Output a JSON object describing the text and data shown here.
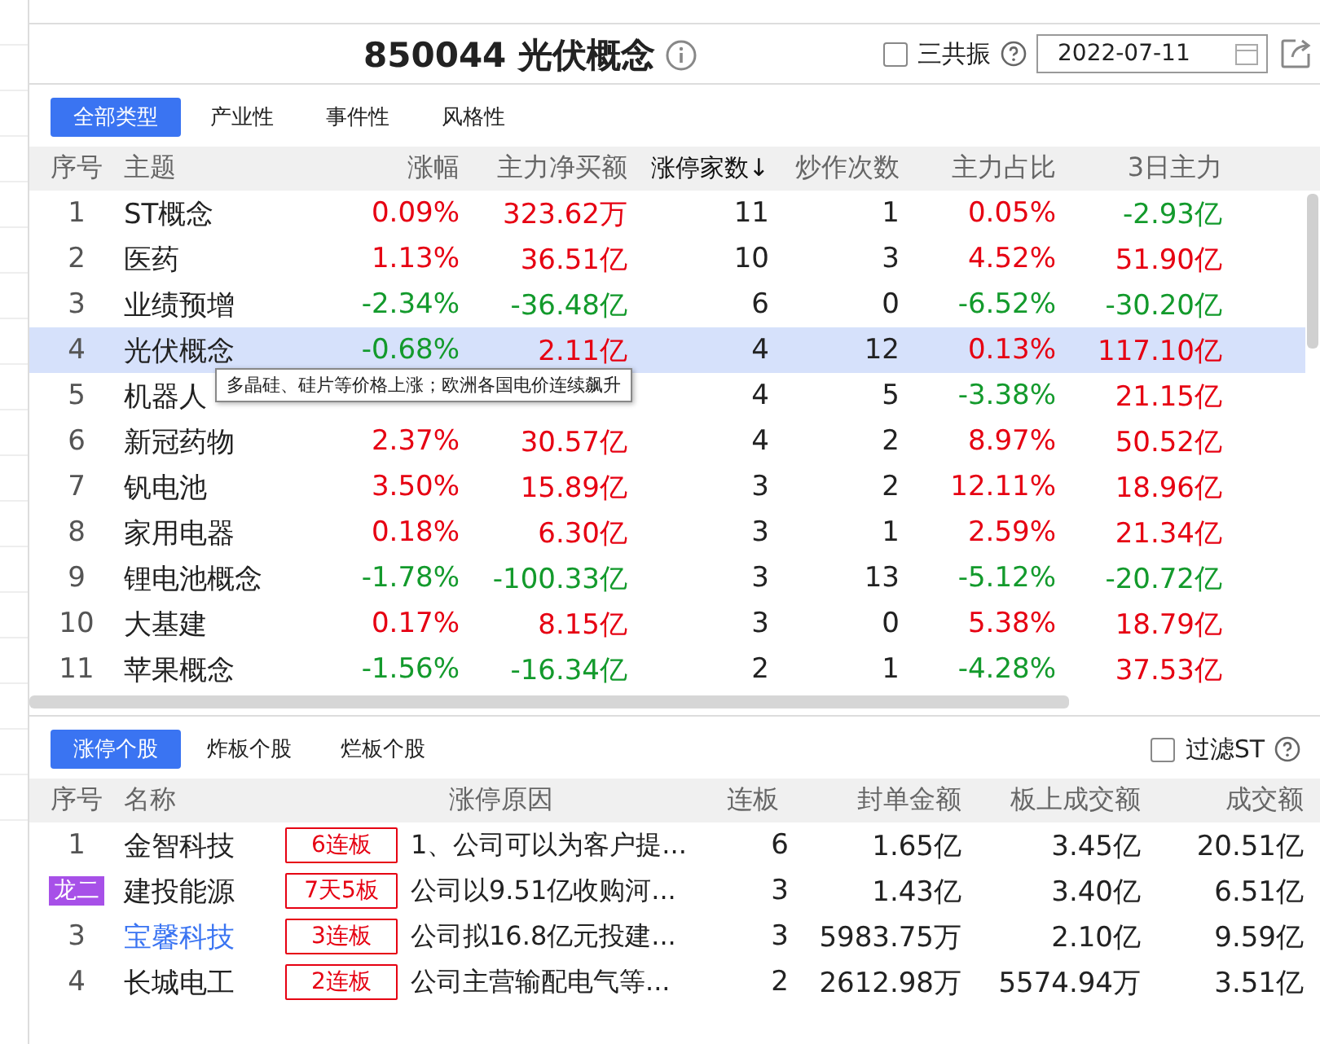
{
  "header": {
    "title": "850044 光伏概念",
    "resonance": {
      "label": "三共振",
      "checked": false
    },
    "date": "2022-07-11"
  },
  "category_tabs": [
    {
      "label": "全部类型",
      "selected": true
    },
    {
      "label": "产业性",
      "selected": false
    },
    {
      "label": "事件性",
      "selected": false
    },
    {
      "label": "风格性",
      "selected": false
    }
  ],
  "themes": {
    "columns": [
      {
        "label": "序号",
        "sorted": false
      },
      {
        "label": "主题",
        "sorted": false
      },
      {
        "label": "涨幅",
        "sorted": false
      },
      {
        "label": "主力净买额",
        "sorted": false
      },
      {
        "label": "涨停家数↓",
        "sorted": true
      },
      {
        "label": "炒作次数",
        "sorted": false
      },
      {
        "label": "主力占比",
        "sorted": false
      },
      {
        "label": "3日主力",
        "sorted": false
      }
    ],
    "rows": [
      {
        "no": "1",
        "name": "ST概念",
        "change": "0.09%",
        "change_up": true,
        "net": "323.62万",
        "net_up": true,
        "limit_up": "11",
        "times": "1",
        "ratio": "0.05%",
        "ratio_up": true,
        "d3": "-2.93亿",
        "d3_up": false,
        "selected": false
      },
      {
        "no": "2",
        "name": "医药",
        "change": "1.13%",
        "change_up": true,
        "net": "36.51亿",
        "net_up": true,
        "limit_up": "10",
        "times": "3",
        "ratio": "4.52%",
        "ratio_up": true,
        "d3": "51.90亿",
        "d3_up": true,
        "selected": false
      },
      {
        "no": "3",
        "name": "业绩预增",
        "change": "-2.34%",
        "change_up": false,
        "net": "-36.48亿",
        "net_up": false,
        "limit_up": "6",
        "times": "0",
        "ratio": "-6.52%",
        "ratio_up": false,
        "d3": "-30.20亿",
        "d3_up": false,
        "selected": false
      },
      {
        "no": "4",
        "name": "光伏概念",
        "change": "-0.68%",
        "change_up": false,
        "net": "2.11亿",
        "net_up": true,
        "limit_up": "4",
        "times": "12",
        "ratio": "0.13%",
        "ratio_up": true,
        "d3": "117.10亿",
        "d3_up": true,
        "selected": true
      },
      {
        "no": "5",
        "name": "机器人",
        "limit_up": "4",
        "times": "5",
        "ratio": "-3.38%",
        "ratio_up": false,
        "d3": "21.15亿",
        "d3_up": true,
        "selected": false
      },
      {
        "no": "6",
        "name": "新冠药物",
        "change": "2.37%",
        "change_up": true,
        "net": "30.57亿",
        "net_up": true,
        "limit_up": "4",
        "times": "2",
        "ratio": "8.97%",
        "ratio_up": true,
        "d3": "50.52亿",
        "d3_up": true,
        "selected": false
      },
      {
        "no": "7",
        "name": "钒电池",
        "change": "3.50%",
        "change_up": true,
        "net": "15.89亿",
        "net_up": true,
        "limit_up": "3",
        "times": "2",
        "ratio": "12.11%",
        "ratio_up": true,
        "d3": "18.96亿",
        "d3_up": true,
        "selected": false
      },
      {
        "no": "8",
        "name": "家用电器",
        "change": "0.18%",
        "change_up": true,
        "net": "6.30亿",
        "net_up": true,
        "limit_up": "3",
        "times": "1",
        "ratio": "2.59%",
        "ratio_up": true,
        "d3": "21.34亿",
        "d3_up": true,
        "selected": false
      },
      {
        "no": "9",
        "name": "锂电池概念",
        "change": "-1.78%",
        "change_up": false,
        "net": "-100.33亿",
        "net_up": false,
        "limit_up": "3",
        "times": "13",
        "ratio": "-5.12%",
        "ratio_up": false,
        "d3": "-20.72亿",
        "d3_up": false,
        "selected": false
      },
      {
        "no": "10",
        "name": "大基建",
        "change": "0.17%",
        "change_up": true,
        "net": "8.15亿",
        "net_up": true,
        "limit_up": "3",
        "times": "0",
        "ratio": "5.38%",
        "ratio_up": true,
        "d3": "18.79亿",
        "d3_up": true,
        "selected": false
      },
      {
        "no": "11",
        "name": "苹果概念",
        "change": "-1.56%",
        "change_up": false,
        "net": "-16.34亿",
        "net_up": false,
        "limit_up": "2",
        "times": "1",
        "ratio": "-4.28%",
        "ratio_up": false,
        "d3": "37.53亿",
        "d3_up": true,
        "selected": false
      }
    ],
    "tooltip": "多晶硅、硅片等价格上涨；欧洲各国电价连续飙升"
  },
  "stock_tabs": [
    {
      "label": "涨停个股",
      "selected": true
    },
    {
      "label": "炸板个股",
      "selected": false
    },
    {
      "label": "烂板个股",
      "selected": false
    }
  ],
  "filter_st": {
    "label": "过滤ST",
    "checked": false
  },
  "stocks": {
    "columns": [
      "序号",
      "名称",
      "涨停原因",
      "连板",
      "封单金额",
      "板上成交额",
      "成交额"
    ],
    "rows": [
      {
        "kind": "number",
        "no": "1",
        "name": "金智科技",
        "link": false,
        "streak": "6连板",
        "reason": "1、公司可以为客户提...",
        "boards": "6",
        "seal": "1.65亿",
        "on_board": "3.45亿",
        "volume": "20.51亿"
      },
      {
        "kind": "tag",
        "no": "龙二",
        "name": "建投能源",
        "link": false,
        "streak": "7天5板",
        "reason": "公司以9.51亿收购河...",
        "boards": "3",
        "seal": "1.43亿",
        "on_board": "3.40亿",
        "volume": "6.51亿"
      },
      {
        "kind": "number",
        "no": "3",
        "name": "宝馨科技",
        "link": true,
        "streak": "3连板",
        "reason": "公司拟16.8亿元投建...",
        "boards": "3",
        "seal": "5983.75万",
        "on_board": "2.10亿",
        "volume": "9.59亿"
      },
      {
        "kind": "number",
        "no": "4",
        "name": "长城电工",
        "link": false,
        "streak": "2连板",
        "reason": "公司主营输配电气等...",
        "boards": "2",
        "seal": "2612.98万",
        "on_board": "5574.94万",
        "volume": "3.51亿"
      }
    ]
  }
}
